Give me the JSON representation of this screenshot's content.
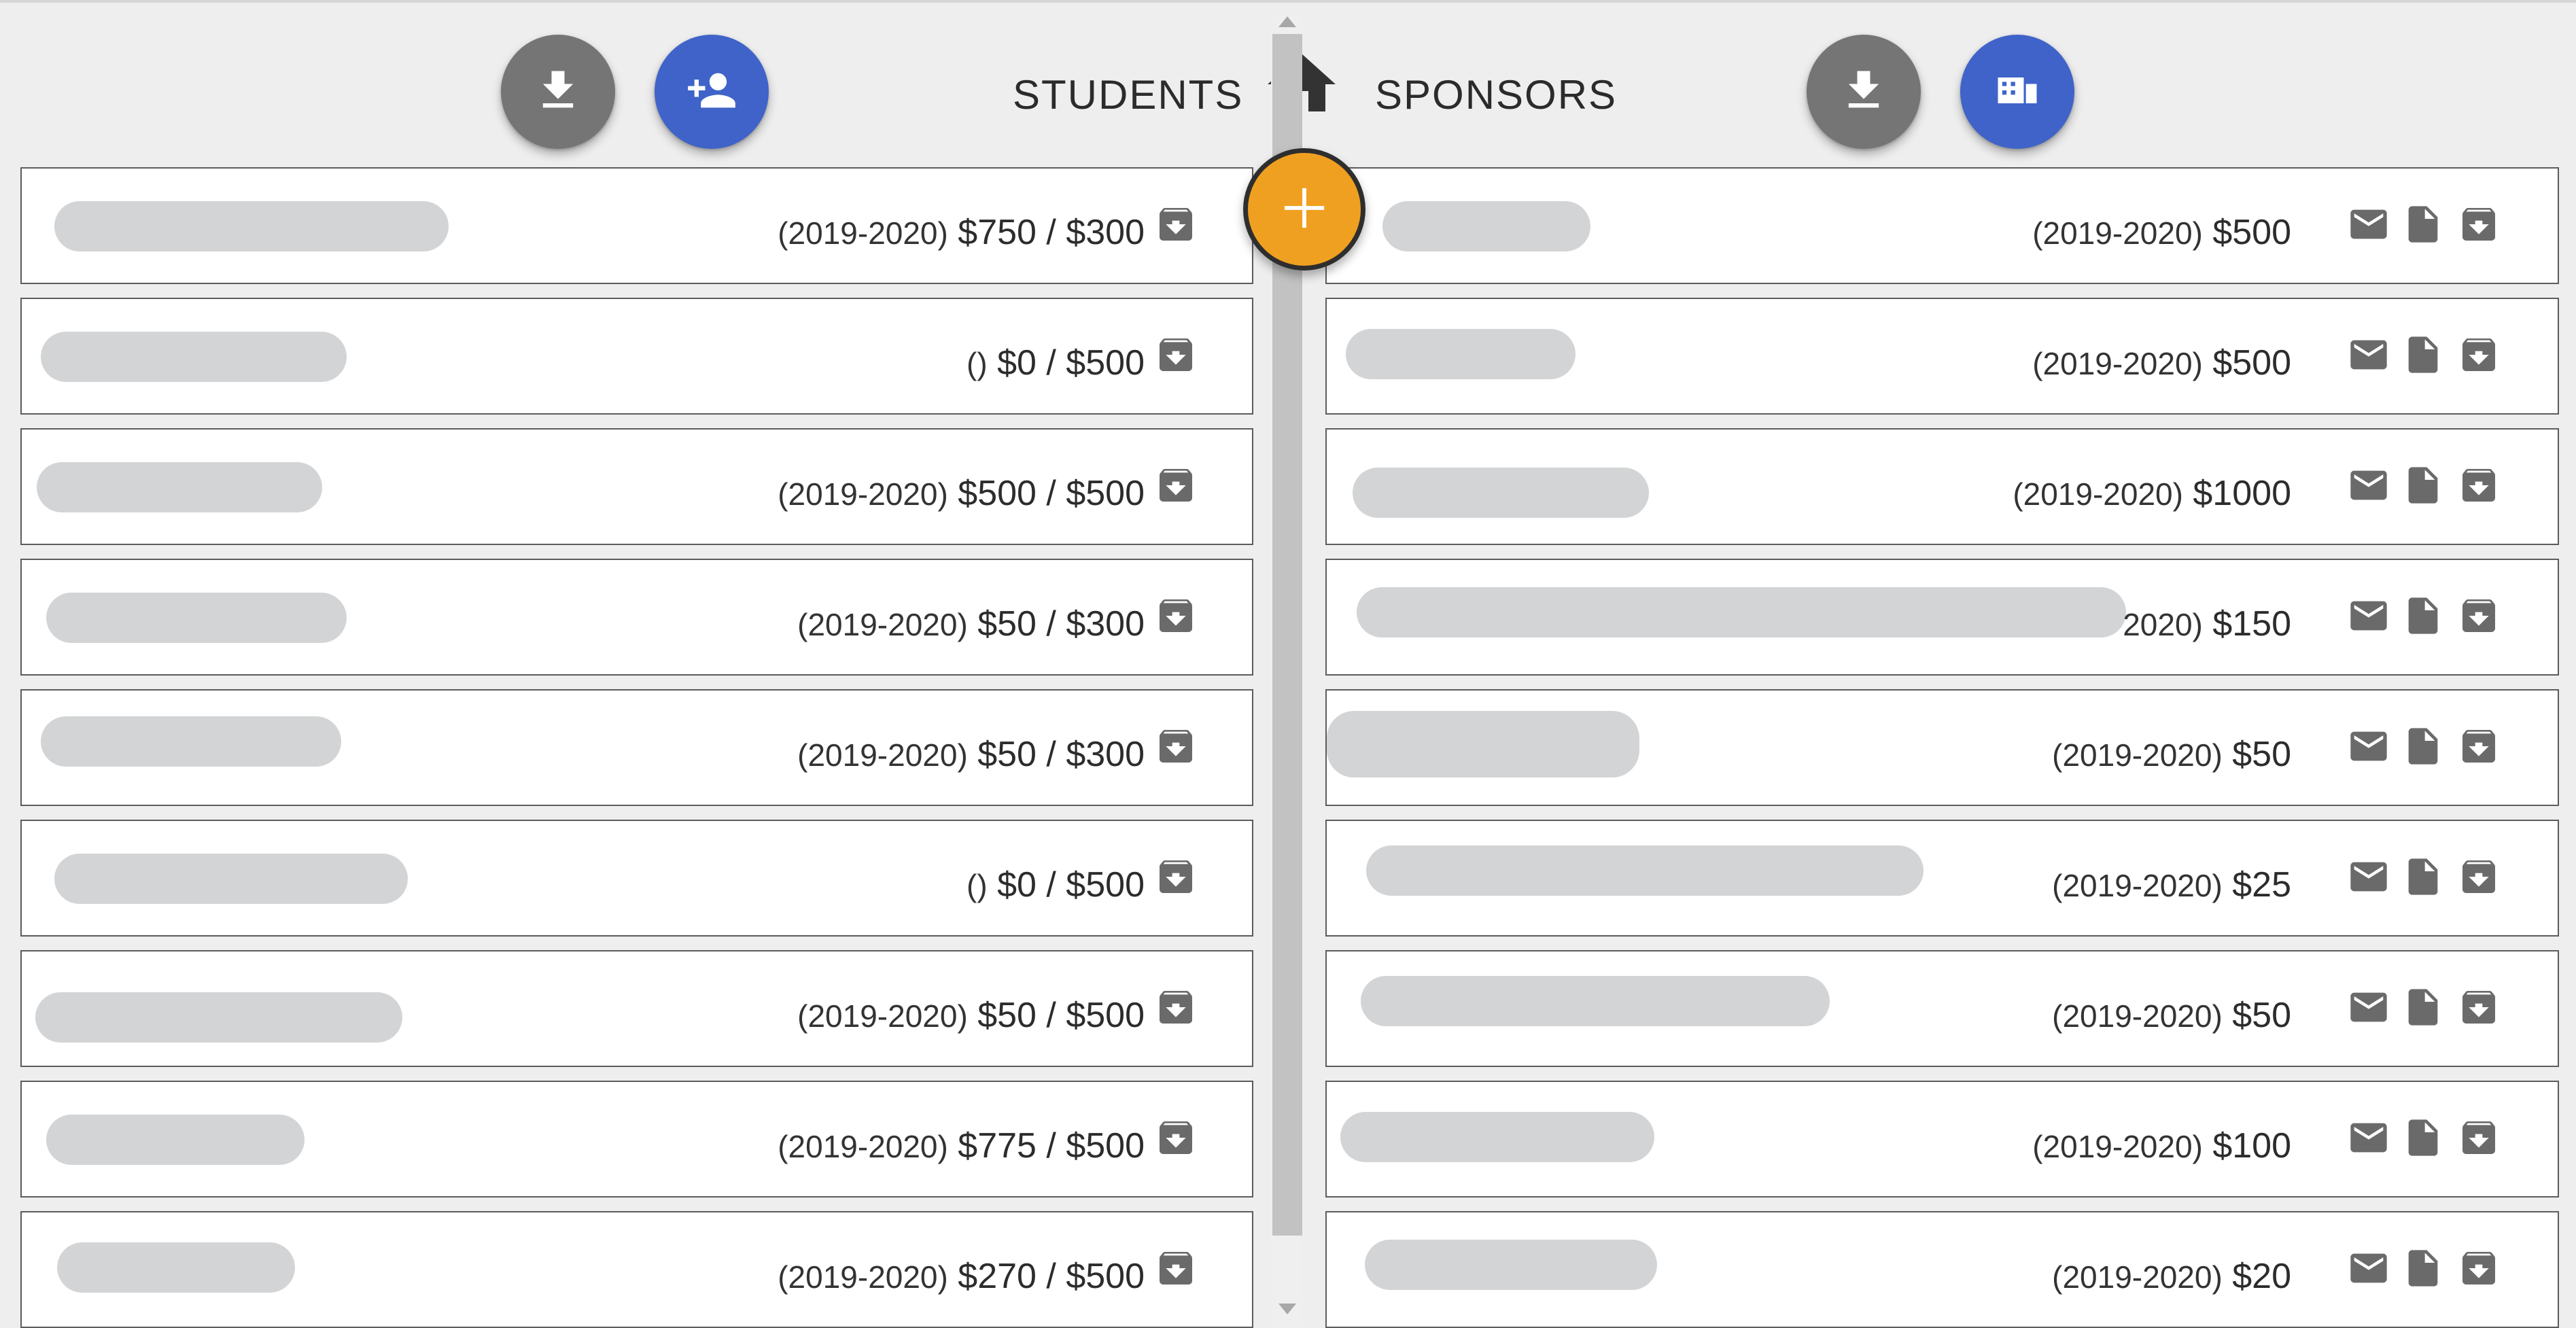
{
  "header": {
    "students_title": "STUDENTS",
    "sponsors_title": "SPONSORS",
    "icons": {
      "download": "download-icon",
      "add_person": "person-add-icon",
      "home": "home-icon",
      "organization": "business-icon",
      "add": "plus-icon"
    }
  },
  "colors": {
    "fab_gray": "#757575",
    "fab_blue": "#3f63c9",
    "fab_orange": "#f0a020",
    "redaction": "#d3d4d6"
  },
  "students": [
    {
      "year": "(2019-2020)",
      "amount": "$750 / $300"
    },
    {
      "year": "()",
      "amount": "$0 / $500"
    },
    {
      "year": "(2019-2020)",
      "amount": "$500 / $500"
    },
    {
      "year": "(2019-2020)",
      "amount": "$50 / $300"
    },
    {
      "year": "(2019-2020)",
      "amount": "$50 / $300"
    },
    {
      "year": "()",
      "amount": "$0 / $500"
    },
    {
      "year": "(2019-2020)",
      "amount": "$50 / $500"
    },
    {
      "year": "(2019-2020)",
      "amount": "$775 / $500"
    },
    {
      "year": "(2019-2020)",
      "amount": "$270 / $500"
    }
  ],
  "sponsors": [
    {
      "year": "(2019-2020)",
      "amount": "$500"
    },
    {
      "year": "(2019-2020)",
      "amount": "$500"
    },
    {
      "year": "(2019-2020)",
      "amount": "$1000"
    },
    {
      "year": "2020)",
      "amount": "$150"
    },
    {
      "year": "(2019-2020)",
      "amount": "$50"
    },
    {
      "year": "(2019-2020)",
      "amount": "$25"
    },
    {
      "year": "(2019-2020)",
      "amount": "$50"
    },
    {
      "year": "(2019-2020)",
      "amount": "$100"
    },
    {
      "year": "(2019-2020)",
      "amount": "$20"
    }
  ]
}
